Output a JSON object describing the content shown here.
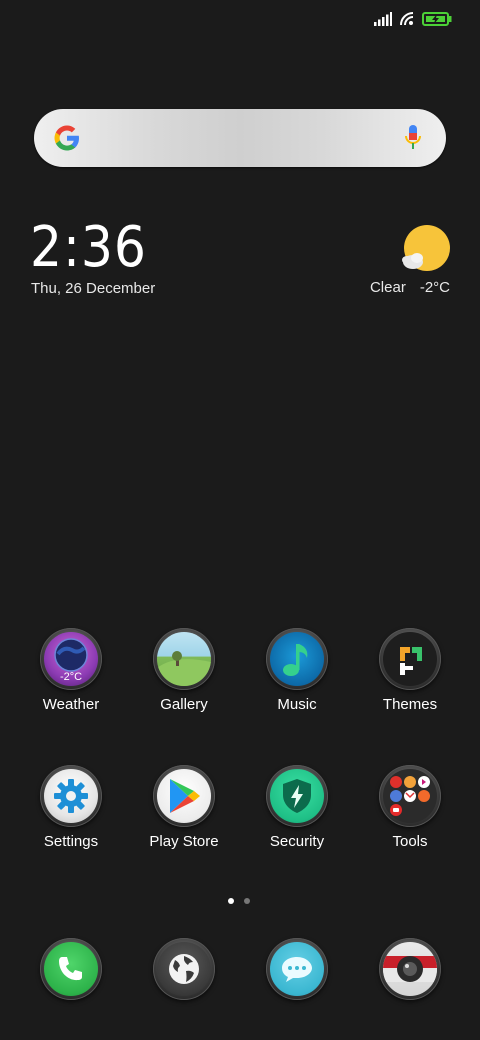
{
  "status": {
    "icons": [
      "signal-icon",
      "wifi-icon",
      "battery-charging-icon"
    ]
  },
  "search": {
    "icons": [
      "google-icon",
      "mic-icon"
    ]
  },
  "clock": {
    "time": "2:36",
    "date": "Thu, 26 December"
  },
  "weather_widget": {
    "condition": "Clear",
    "temperature": "-2°C"
  },
  "apps_row1": [
    {
      "label": "Weather",
      "badge": "-2°C"
    },
    {
      "label": "Gallery"
    },
    {
      "label": "Music"
    },
    {
      "label": "Themes"
    }
  ],
  "apps_row2": [
    {
      "label": "Settings"
    },
    {
      "label": "Play Store"
    },
    {
      "label": "Security"
    },
    {
      "label": "Tools"
    }
  ],
  "dock": {
    "icons": [
      "phone-icon",
      "browser-icon",
      "messages-icon",
      "camera-icon"
    ]
  },
  "page_indicator": {
    "pages": 2,
    "current": 1
  }
}
